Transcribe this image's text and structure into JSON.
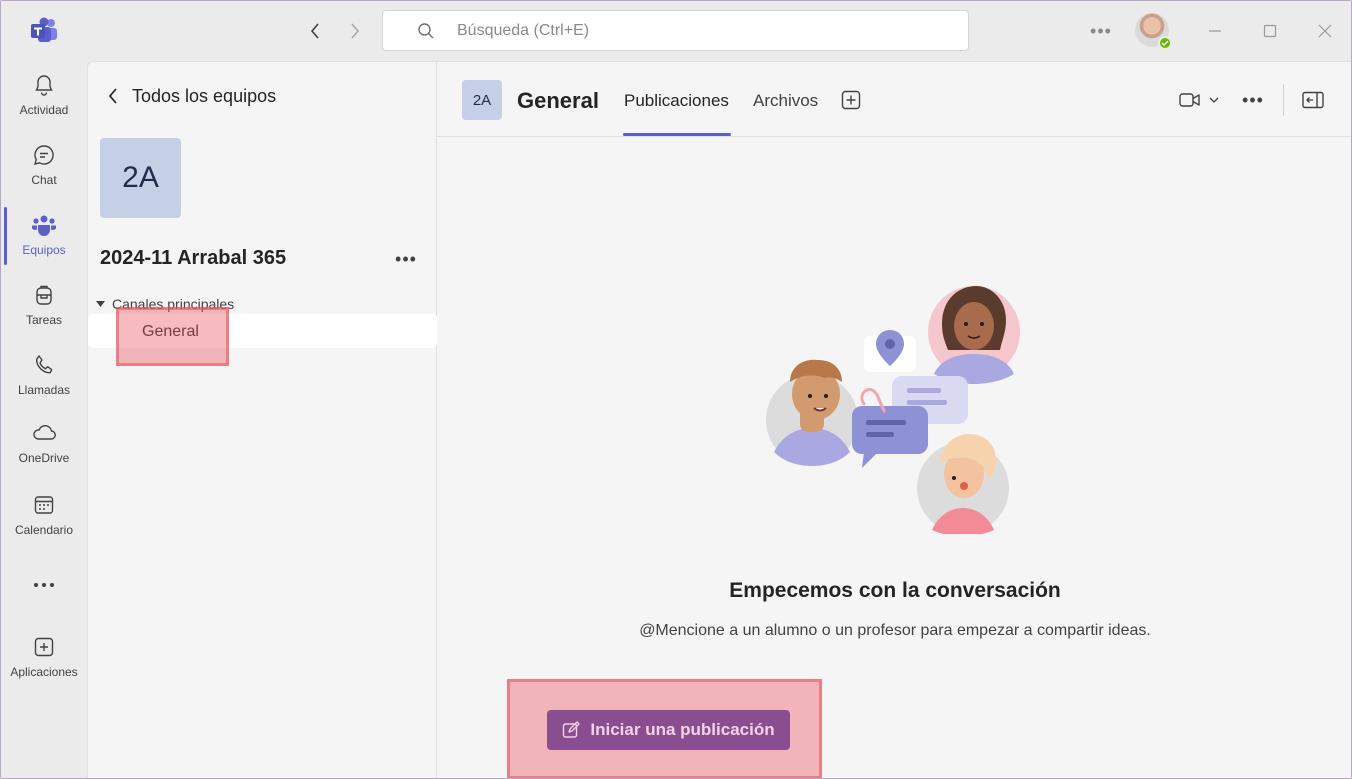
{
  "search": {
    "placeholder": "Búsqueda (Ctrl+E)"
  },
  "rail": {
    "items": [
      {
        "label": "Actividad",
        "icon": "bell-icon"
      },
      {
        "label": "Chat",
        "icon": "chat-icon"
      },
      {
        "label": "Equipos",
        "icon": "teams-icon"
      },
      {
        "label": "Tareas",
        "icon": "backpack-icon"
      },
      {
        "label": "Llamadas",
        "icon": "phone-icon"
      },
      {
        "label": "OneDrive",
        "icon": "cloud-icon"
      },
      {
        "label": "Calendario",
        "icon": "calendar-icon"
      },
      {
        "label": "",
        "icon": "more-icon"
      },
      {
        "label": "Aplicaciones",
        "icon": "add-app-icon"
      }
    ],
    "active": "Equipos"
  },
  "panel": {
    "back_label": "Todos los equipos",
    "team_initials": "2A",
    "team_name": "2024-11 Arrabal 365",
    "section_label": "Canales principales",
    "channels": [
      {
        "label": "General"
      }
    ]
  },
  "main": {
    "channel_initials": "2A",
    "channel_title": "General",
    "tabs": [
      {
        "label": "Publicaciones"
      },
      {
        "label": "Archivos"
      }
    ],
    "empty_title": "Empecemos con la conversación",
    "empty_subtitle": "@Mencione a un alumno o un profesor para empezar a compartir ideas.",
    "post_button_label": "Iniciar una publicación"
  },
  "colors": {
    "accent": "#5b5fc7",
    "post_button": "#8a4d8f",
    "highlight": "#eb5a64",
    "presence": "#6bb700",
    "team_tile": "#c5d0e6"
  }
}
